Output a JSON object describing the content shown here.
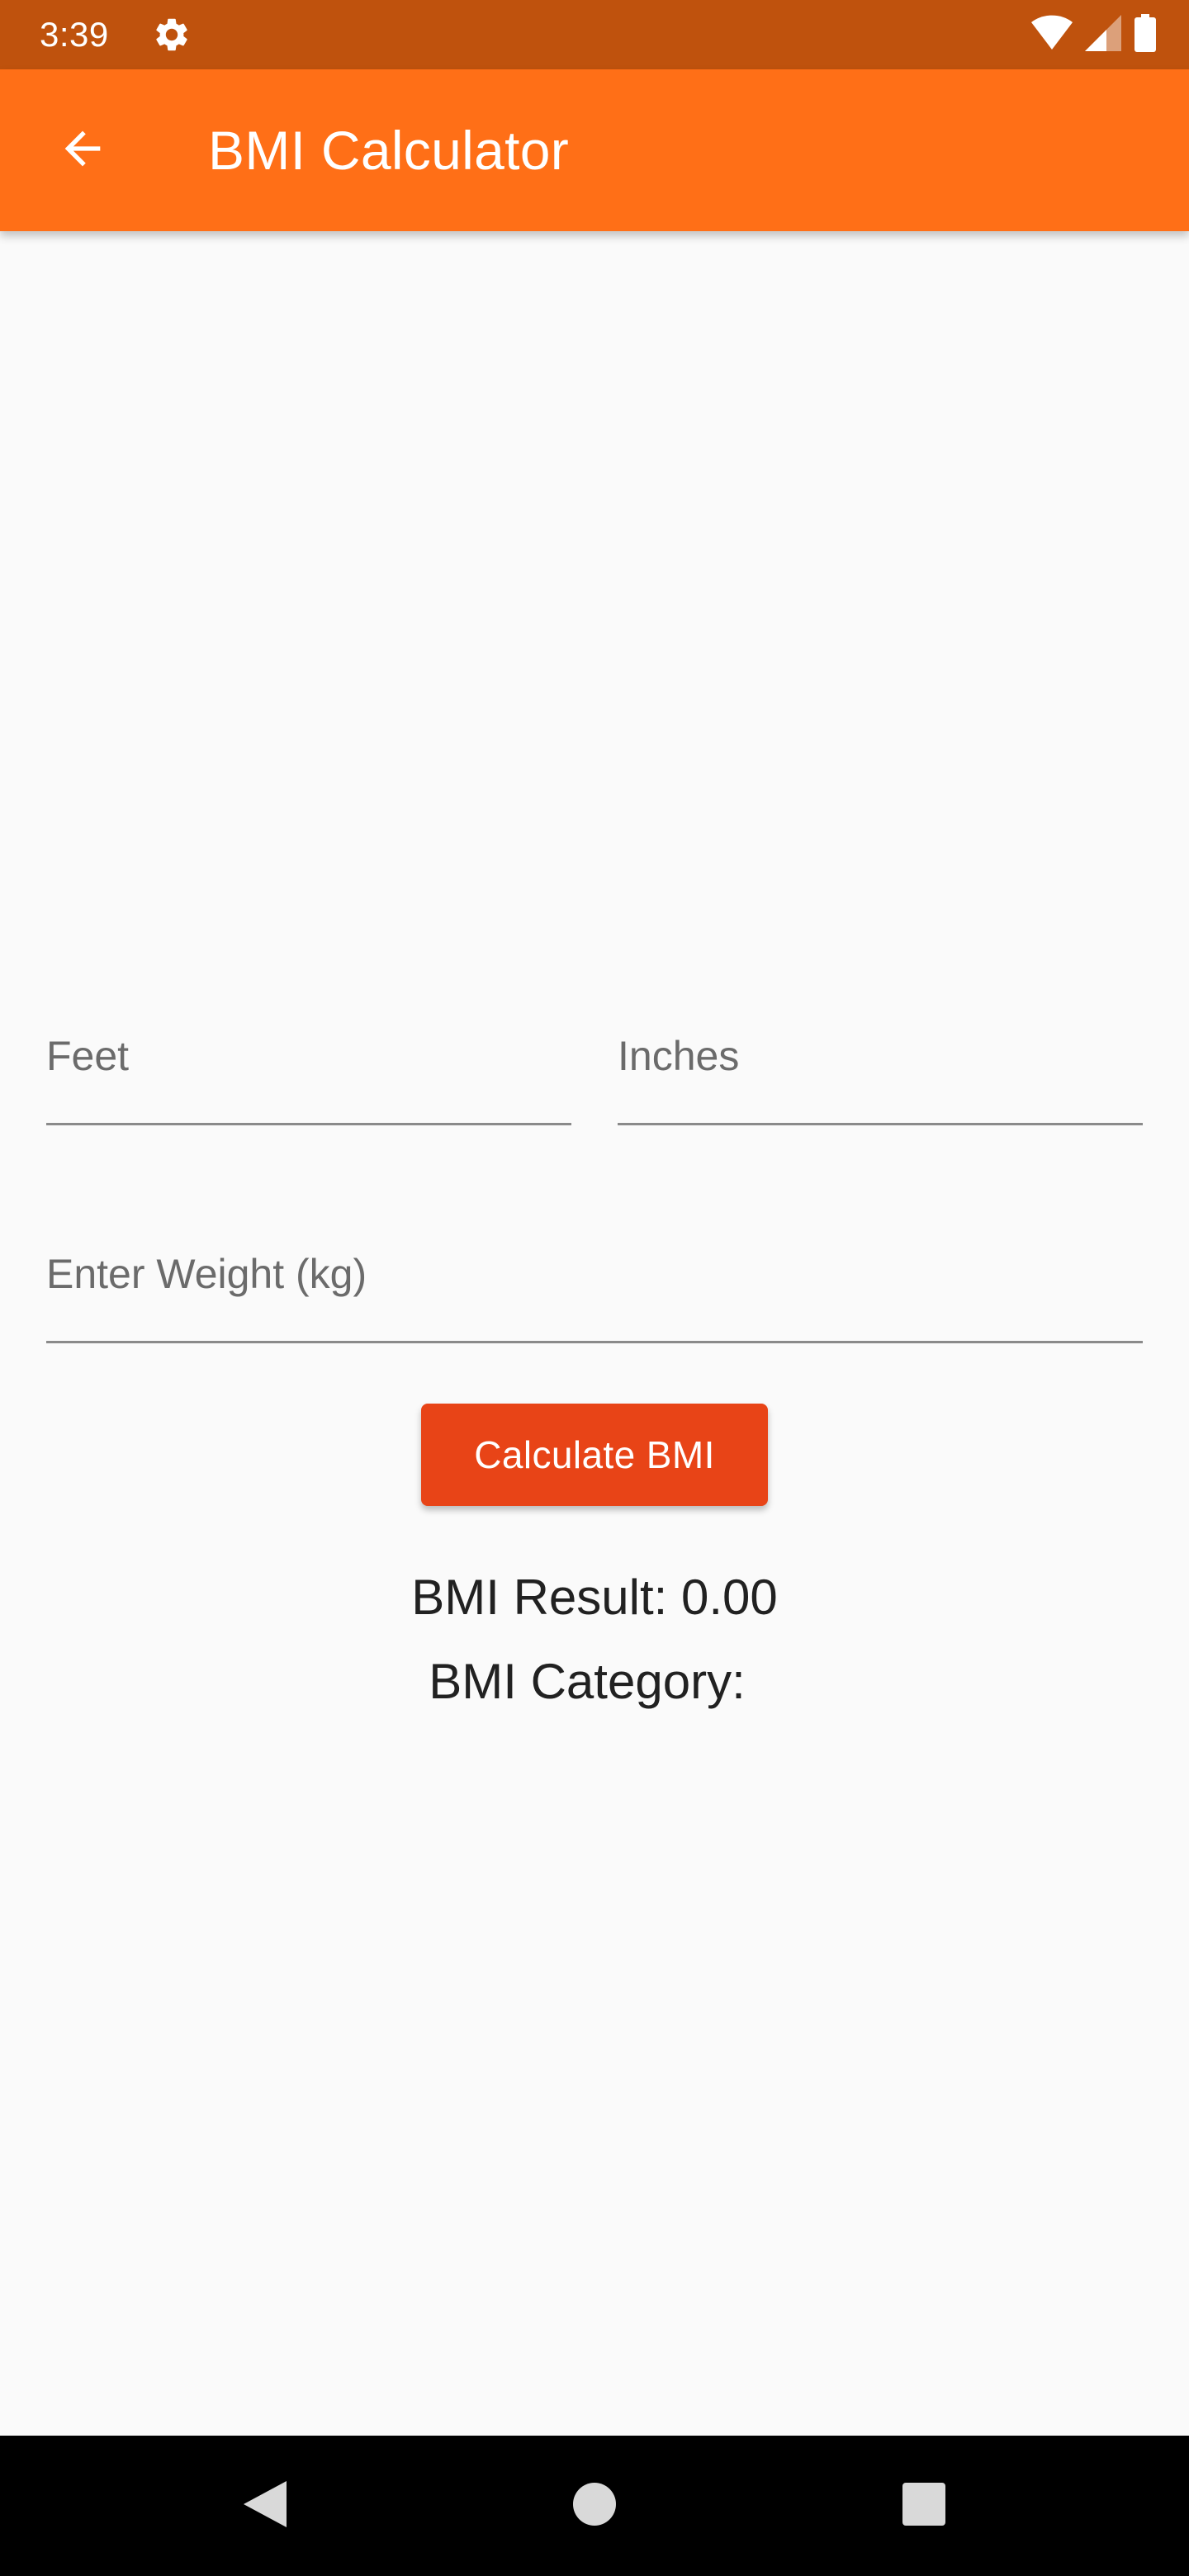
{
  "status_bar": {
    "time": "3:39",
    "icons": [
      "gear-icon",
      "wifi-icon",
      "signal-icon",
      "battery-icon"
    ]
  },
  "app_bar": {
    "title": "BMI Calculator",
    "back_icon": "arrow-left-icon"
  },
  "form": {
    "feet": {
      "label": "Feet",
      "value": ""
    },
    "inches": {
      "label": "Inches",
      "value": ""
    },
    "weight": {
      "label": "Enter Weight (kg)",
      "value": ""
    }
  },
  "calculate_button": {
    "label": "Calculate BMI"
  },
  "result": {
    "bmi_label": "BMI Result:",
    "bmi_value": "0.00",
    "category_label": "BMI Category:",
    "category_value": ""
  },
  "nav_bar": {
    "icons": [
      "nav-back-icon",
      "nav-home-icon",
      "nav-recents-icon"
    ]
  },
  "colors": {
    "status_bar": "#bf520d",
    "app_bar": "#ff6f17",
    "button": "#e84417",
    "background": "#fafafa"
  }
}
